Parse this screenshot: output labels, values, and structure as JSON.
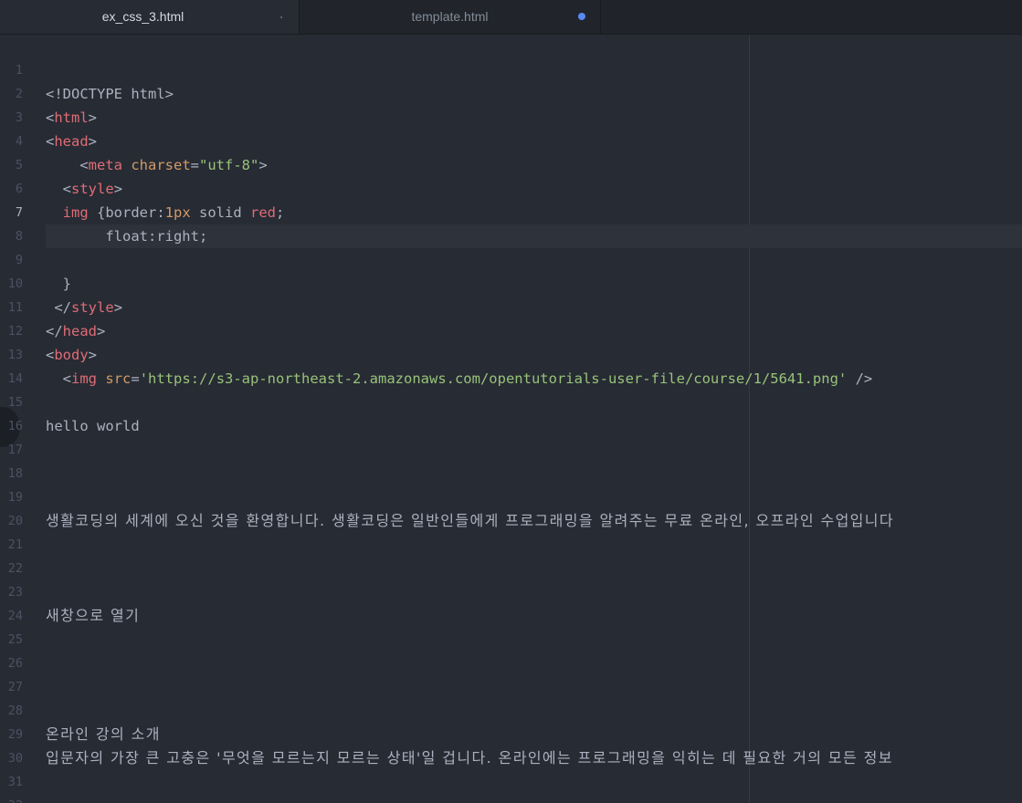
{
  "tabs": [
    {
      "label": "ex_css_3.html",
      "active": true,
      "modified": false
    },
    {
      "label": "template.html",
      "active": false,
      "modified": true
    }
  ],
  "colors": {
    "background": "#272b34",
    "tag": "#e06c75",
    "attribute": "#d19a66",
    "string": "#98c379",
    "text": "#abb2bf",
    "modified_dot": "#578af2"
  },
  "editor": {
    "cursor_line": 7,
    "line_numbers": [
      "1",
      "2",
      "3",
      "4",
      "5",
      "6",
      "7",
      "8",
      "9",
      "10",
      "11",
      "12",
      "13",
      "14",
      "15",
      "16",
      "17",
      "18",
      "19",
      "20",
      "21",
      "22",
      "23",
      "24",
      "25",
      "26",
      "27",
      "28",
      "29",
      "30",
      "31",
      "32"
    ],
    "code": {
      "l1": "<!DOCTYPE html>",
      "l2_lt": "<",
      "l2_tag": "html",
      "l2_gt": ">",
      "l3_lt": "<",
      "l3_tag": "head",
      "l3_gt": ">",
      "l4_indent": "    ",
      "l4_lt": "<",
      "l4_tag": "meta",
      "l4_sp": " ",
      "l4_attr": "charset",
      "l4_eq": "=",
      "l4_val": "\"utf-8\"",
      "l4_gt": ">",
      "l5_indent": "  ",
      "l5_lt": "<",
      "l5_tag": "style",
      "l5_gt": ">",
      "l6_indent": "  ",
      "l6_sel": "img",
      "l6_a": " {border:",
      "l6_num": "1px",
      "l6_b": " solid ",
      "l6_red": "red",
      "l6_c": ";",
      "l7": "       float:right;",
      "l9": "  }",
      "l10_indent": " ",
      "l10_lt": "</",
      "l10_tag": "style",
      "l10_gt": ">",
      "l11_lt": "</",
      "l11_tag": "head",
      "l11_gt": ">",
      "l12_lt": "<",
      "l12_tag": "body",
      "l12_gt": ">",
      "l13_indent": "  ",
      "l13_lt": "<",
      "l13_tag": "img",
      "l13_sp": " ",
      "l13_attr": "src",
      "l13_eq": "=",
      "l13_val": "'https://s3-ap-northeast-2.amazonaws.com/opentutorials-user-file/course/1/5641.png'",
      "l13_end": " />",
      "l15": "hello world",
      "l19": "생활코딩의 세계에 오신 것을 환영합니다. 생활코딩은 일반인들에게 프로그래밍을 알려주는 무료 온라인, 오프라인 수업입니다",
      "l23": "새창으로 열기",
      "l28": "온라인 강의 소개",
      "l29": "입문자의 가장 큰 고충은 '무엇을 모르는지 모르는 상태'일 겁니다. 온라인에는 프로그래밍을 익히는 데 필요한 거의 모든 정보"
    }
  }
}
